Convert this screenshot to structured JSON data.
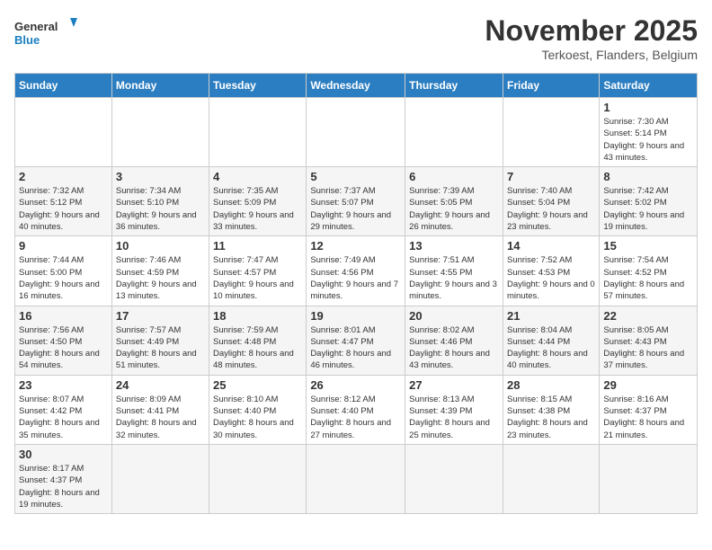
{
  "header": {
    "logo_general": "General",
    "logo_blue": "Blue",
    "month_title": "November 2025",
    "location": "Terkoest, Flanders, Belgium"
  },
  "weekdays": [
    "Sunday",
    "Monday",
    "Tuesday",
    "Wednesday",
    "Thursday",
    "Friday",
    "Saturday"
  ],
  "weeks": [
    [
      {
        "day": "",
        "info": ""
      },
      {
        "day": "",
        "info": ""
      },
      {
        "day": "",
        "info": ""
      },
      {
        "day": "",
        "info": ""
      },
      {
        "day": "",
        "info": ""
      },
      {
        "day": "",
        "info": ""
      },
      {
        "day": "1",
        "info": "Sunrise: 7:30 AM\nSunset: 5:14 PM\nDaylight: 9 hours\nand 43 minutes."
      }
    ],
    [
      {
        "day": "2",
        "info": "Sunrise: 7:32 AM\nSunset: 5:12 PM\nDaylight: 9 hours\nand 40 minutes."
      },
      {
        "day": "3",
        "info": "Sunrise: 7:34 AM\nSunset: 5:10 PM\nDaylight: 9 hours\nand 36 minutes."
      },
      {
        "day": "4",
        "info": "Sunrise: 7:35 AM\nSunset: 5:09 PM\nDaylight: 9 hours\nand 33 minutes."
      },
      {
        "day": "5",
        "info": "Sunrise: 7:37 AM\nSunset: 5:07 PM\nDaylight: 9 hours\nand 29 minutes."
      },
      {
        "day": "6",
        "info": "Sunrise: 7:39 AM\nSunset: 5:05 PM\nDaylight: 9 hours\nand 26 minutes."
      },
      {
        "day": "7",
        "info": "Sunrise: 7:40 AM\nSunset: 5:04 PM\nDaylight: 9 hours\nand 23 minutes."
      },
      {
        "day": "8",
        "info": "Sunrise: 7:42 AM\nSunset: 5:02 PM\nDaylight: 9 hours\nand 19 minutes."
      }
    ],
    [
      {
        "day": "9",
        "info": "Sunrise: 7:44 AM\nSunset: 5:00 PM\nDaylight: 9 hours\nand 16 minutes."
      },
      {
        "day": "10",
        "info": "Sunrise: 7:46 AM\nSunset: 4:59 PM\nDaylight: 9 hours\nand 13 minutes."
      },
      {
        "day": "11",
        "info": "Sunrise: 7:47 AM\nSunset: 4:57 PM\nDaylight: 9 hours\nand 10 minutes."
      },
      {
        "day": "12",
        "info": "Sunrise: 7:49 AM\nSunset: 4:56 PM\nDaylight: 9 hours\nand 7 minutes."
      },
      {
        "day": "13",
        "info": "Sunrise: 7:51 AM\nSunset: 4:55 PM\nDaylight: 9 hours\nand 3 minutes."
      },
      {
        "day": "14",
        "info": "Sunrise: 7:52 AM\nSunset: 4:53 PM\nDaylight: 9 hours\nand 0 minutes."
      },
      {
        "day": "15",
        "info": "Sunrise: 7:54 AM\nSunset: 4:52 PM\nDaylight: 8 hours\nand 57 minutes."
      }
    ],
    [
      {
        "day": "16",
        "info": "Sunrise: 7:56 AM\nSunset: 4:50 PM\nDaylight: 8 hours\nand 54 minutes."
      },
      {
        "day": "17",
        "info": "Sunrise: 7:57 AM\nSunset: 4:49 PM\nDaylight: 8 hours\nand 51 minutes."
      },
      {
        "day": "18",
        "info": "Sunrise: 7:59 AM\nSunset: 4:48 PM\nDaylight: 8 hours\nand 48 minutes."
      },
      {
        "day": "19",
        "info": "Sunrise: 8:01 AM\nSunset: 4:47 PM\nDaylight: 8 hours\nand 46 minutes."
      },
      {
        "day": "20",
        "info": "Sunrise: 8:02 AM\nSunset: 4:46 PM\nDaylight: 8 hours\nand 43 minutes."
      },
      {
        "day": "21",
        "info": "Sunrise: 8:04 AM\nSunset: 4:44 PM\nDaylight: 8 hours\nand 40 minutes."
      },
      {
        "day": "22",
        "info": "Sunrise: 8:05 AM\nSunset: 4:43 PM\nDaylight: 8 hours\nand 37 minutes."
      }
    ],
    [
      {
        "day": "23",
        "info": "Sunrise: 8:07 AM\nSunset: 4:42 PM\nDaylight: 8 hours\nand 35 minutes."
      },
      {
        "day": "24",
        "info": "Sunrise: 8:09 AM\nSunset: 4:41 PM\nDaylight: 8 hours\nand 32 minutes."
      },
      {
        "day": "25",
        "info": "Sunrise: 8:10 AM\nSunset: 4:40 PM\nDaylight: 8 hours\nand 30 minutes."
      },
      {
        "day": "26",
        "info": "Sunrise: 8:12 AM\nSunset: 4:40 PM\nDaylight: 8 hours\nand 27 minutes."
      },
      {
        "day": "27",
        "info": "Sunrise: 8:13 AM\nSunset: 4:39 PM\nDaylight: 8 hours\nand 25 minutes."
      },
      {
        "day": "28",
        "info": "Sunrise: 8:15 AM\nSunset: 4:38 PM\nDaylight: 8 hours\nand 23 minutes."
      },
      {
        "day": "29",
        "info": "Sunrise: 8:16 AM\nSunset: 4:37 PM\nDaylight: 8 hours\nand 21 minutes."
      }
    ],
    [
      {
        "day": "30",
        "info": "Sunrise: 8:17 AM\nSunset: 4:37 PM\nDaylight: 8 hours\nand 19 minutes."
      },
      {
        "day": "",
        "info": ""
      },
      {
        "day": "",
        "info": ""
      },
      {
        "day": "",
        "info": ""
      },
      {
        "day": "",
        "info": ""
      },
      {
        "day": "",
        "info": ""
      },
      {
        "day": "",
        "info": ""
      }
    ]
  ]
}
